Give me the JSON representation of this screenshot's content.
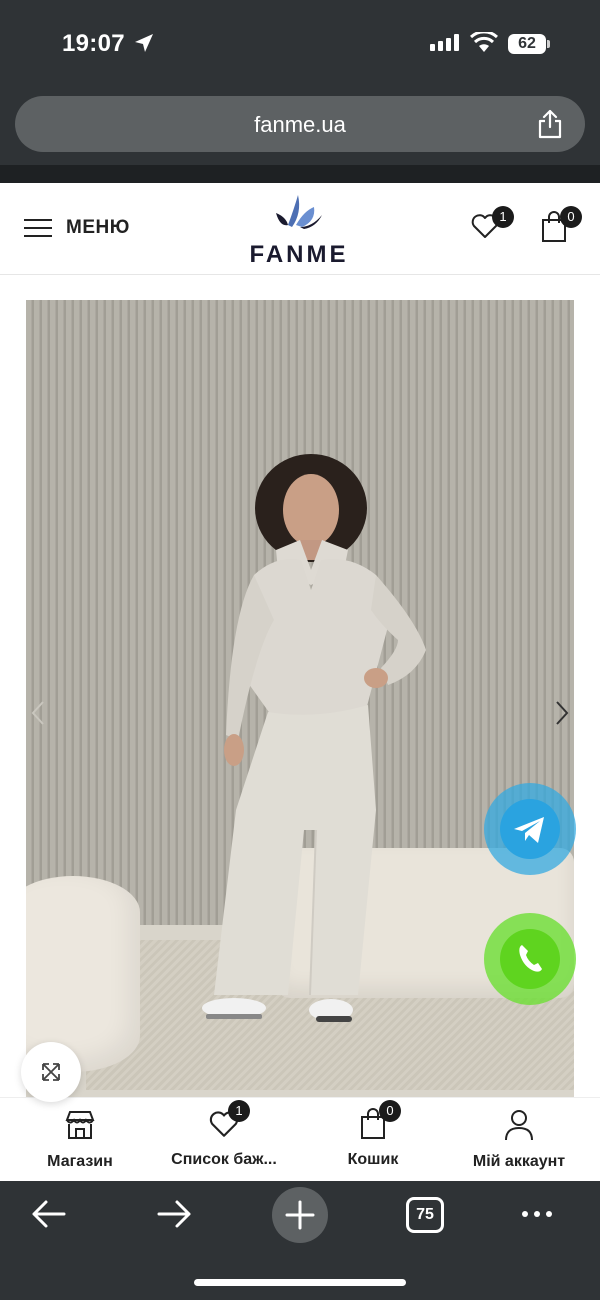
{
  "status_bar": {
    "time": "19:07",
    "battery": "62"
  },
  "browser": {
    "url": "fanme.ua",
    "tabs_count": "75"
  },
  "header": {
    "menu_label": "МЕНЮ",
    "logo_text": "FANME",
    "wishlist_count": "1",
    "cart_count": "0"
  },
  "tabbar": {
    "items": [
      {
        "label": "Магазин",
        "icon": "store-icon"
      },
      {
        "label": "Список баж...",
        "icon": "heart-icon",
        "badge": "1"
      },
      {
        "label": "Кошик",
        "icon": "bag-icon",
        "badge": "0"
      },
      {
        "label": "Мій аккаунт",
        "icon": "user-icon"
      }
    ]
  },
  "colors": {
    "telegram": "#2aa3e0",
    "phone": "#5fd41f",
    "chrome": "#2f3336"
  }
}
